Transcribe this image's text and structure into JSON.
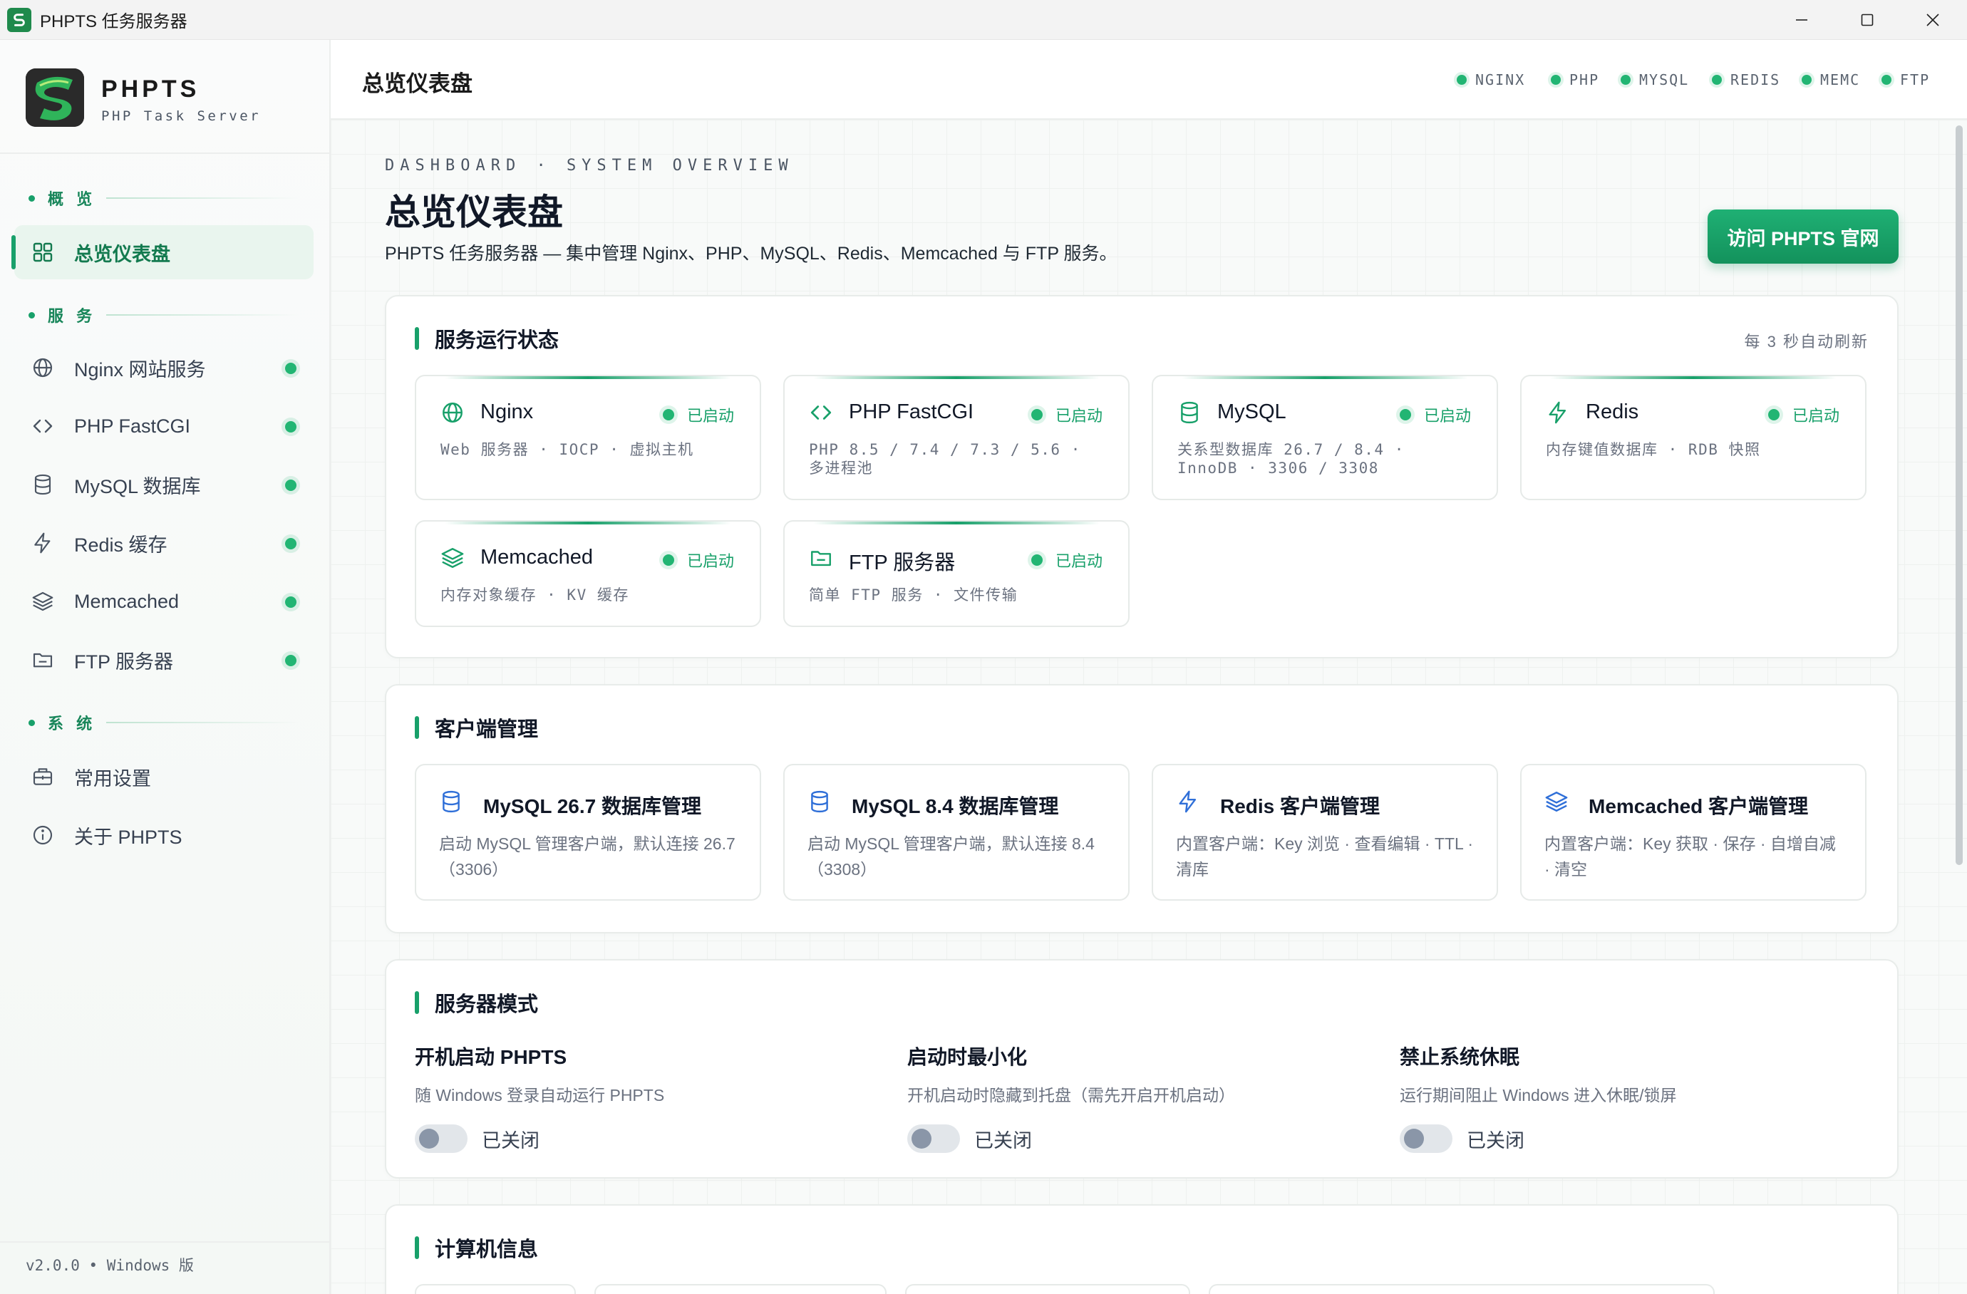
{
  "window": {
    "title": "PHPTS 任务服务器"
  },
  "brand": {
    "name": "PHPTS",
    "subtitle": "PHP Task Server"
  },
  "sidebar": {
    "sections": [
      {
        "label": "概 览"
      },
      {
        "label": "服 务"
      },
      {
        "label": "系 统"
      }
    ],
    "items": [
      {
        "label": "总览仪表盘",
        "icon": "grid-icon",
        "active": true
      },
      {
        "label": "Nginx 网站服务",
        "icon": "globe-icon",
        "status": "running"
      },
      {
        "label": "PHP FastCGI",
        "icon": "code-icon",
        "status": "running"
      },
      {
        "label": "MySQL 数据库",
        "icon": "database-icon",
        "status": "running"
      },
      {
        "label": "Redis 缓存",
        "icon": "bolt-icon",
        "status": "running"
      },
      {
        "label": "Memcached",
        "icon": "layers-icon",
        "status": "running"
      },
      {
        "label": "FTP 服务器",
        "icon": "folder-icon",
        "status": "running"
      },
      {
        "label": "常用设置",
        "icon": "toolbox-icon"
      },
      {
        "label": "关于 PHPTS",
        "icon": "info-icon"
      }
    ],
    "version": "v2.0.0 • Windows 版"
  },
  "topbar": {
    "title": "总览仪表盘",
    "chips": [
      "NGINX",
      "PHP",
      "MYSQL",
      "REDIS",
      "MEMC",
      "FTP"
    ]
  },
  "page": {
    "eyebrow": "DASHBOARD · SYSTEM OVERVIEW",
    "title": "总览仪表盘",
    "description": "PHPTS 任务服务器 — 集中管理 Nginx、PHP、MySQL、Redis、Memcached 与 FTP 服务。",
    "visit_button": "访问 PHPTS 官网"
  },
  "status_panel": {
    "title": "服务运行状态",
    "refresh_note": "每 3 秒自动刷新",
    "services": [
      {
        "name": "Nginx",
        "icon": "globe-icon",
        "status": "已启动",
        "desc": "Web 服务器 · IOCP · 虚拟主机"
      },
      {
        "name": "PHP FastCGI",
        "icon": "code-icon",
        "status": "已启动",
        "desc": "PHP 8.5 / 7.4 / 7.3 / 5.6 · 多进程池"
      },
      {
        "name": "MySQL",
        "icon": "database-icon",
        "status": "已启动",
        "desc": "关系型数据库 26.7 / 8.4 · InnoDB · 3306 / 3308"
      },
      {
        "name": "Redis",
        "icon": "bolt-icon",
        "status": "已启动",
        "desc": "内存键值数据库 · RDB 快照"
      },
      {
        "name": "Memcached",
        "icon": "layers-icon",
        "status": "已启动",
        "desc": "内存对象缓存 · KV 缓存"
      },
      {
        "name": "FTP 服务器",
        "icon": "folder-icon",
        "status": "已启动",
        "desc": "简单 FTP 服务 · 文件传输"
      }
    ]
  },
  "client_panel": {
    "title": "客户端管理",
    "clients": [
      {
        "name": "MySQL 26.7 数据库管理",
        "icon": "database-icon",
        "desc": "启动 MySQL 管理客户端，默认连接 26.7（3306）"
      },
      {
        "name": "MySQL 8.4 数据库管理",
        "icon": "database-icon",
        "desc": "启动 MySQL 管理客户端，默认连接 8.4（3308）"
      },
      {
        "name": "Redis 客户端管理",
        "icon": "bolt-icon",
        "desc": "内置客户端：Key 浏览 · 查看编辑 · TTL · 清库"
      },
      {
        "name": "Memcached 客户端管理",
        "icon": "layers-icon",
        "desc": "内置客户端：Key 获取 · 保存 · 自增自减 · 清空"
      }
    ]
  },
  "mode_panel": {
    "title": "服务器模式",
    "options": [
      {
        "title": "开机启动 PHPTS",
        "desc": "随 Windows 登录自动运行 PHPTS",
        "state": "已关闭"
      },
      {
        "title": "启动时最小化",
        "desc": "开机启动时隐藏到托盘（需先开启开机启动）",
        "state": "已关闭"
      },
      {
        "title": "禁止系统休眠",
        "desc": "运行期间阻止 Windows 进入休眠/锁屏",
        "state": "已关闭"
      }
    ]
  },
  "computer_panel": {
    "title": "计算机信息"
  },
  "colors": {
    "accent": "#18a06a",
    "running": "#22b573",
    "text": "#111827",
    "muted": "#6b7280"
  }
}
